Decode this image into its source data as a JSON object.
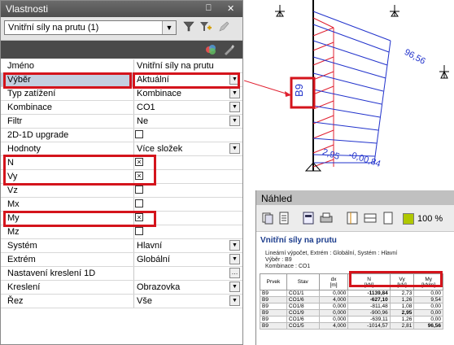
{
  "panel": {
    "title": "Vlastnosti",
    "pin_glyph": "⎕",
    "close_glyph": "✕",
    "selector_value": "Vnitřní síly na prutu (1)",
    "rows": [
      {
        "label": "Jméno",
        "value": "Vnitřní síly na prutu",
        "kind": "text"
      },
      {
        "label": "Výběr",
        "value": "Aktuální",
        "kind": "dropdown"
      },
      {
        "label": "Typ zatížení",
        "value": "Kombinace",
        "kind": "dropdown"
      },
      {
        "label": "Kombinace",
        "value": "CO1",
        "kind": "dropdown"
      },
      {
        "label": "Filtr",
        "value": "Ne",
        "kind": "dropdown"
      },
      {
        "label": "2D-1D upgrade",
        "value": "",
        "kind": "checkbox",
        "checked": false
      },
      {
        "label": "Hodnoty",
        "value": "Více složek",
        "kind": "dropdown"
      },
      {
        "label": "N",
        "value": "",
        "kind": "checkbox",
        "checked": true
      },
      {
        "label": "Vy",
        "value": "",
        "kind": "checkbox",
        "checked": true
      },
      {
        "label": "Vz",
        "value": "",
        "kind": "checkbox",
        "checked": false
      },
      {
        "label": "Mx",
        "value": "",
        "kind": "checkbox",
        "checked": false
      },
      {
        "label": "My",
        "value": "",
        "kind": "checkbox",
        "checked": true
      },
      {
        "label": "Mz",
        "value": "",
        "kind": "checkbox",
        "checked": false
      },
      {
        "label": "Systém",
        "value": "Hlavní",
        "kind": "dropdown"
      },
      {
        "label": "Extrém",
        "value": "Globální",
        "kind": "dropdown"
      },
      {
        "label": "Nastavení kreslení 1D",
        "value": "",
        "kind": "dots"
      },
      {
        "label": "Kreslení",
        "value": "Obrazovka",
        "kind": "dropdown"
      },
      {
        "label": "Řez",
        "value": "Vše",
        "kind": "dropdown"
      }
    ]
  },
  "drawing": {
    "member_label": "B9",
    "value_top": "96,56",
    "value_bottom_left": "2,95",
    "value_bottom_right": "-0,00,84"
  },
  "preview": {
    "title": "Náhled",
    "zoom": "100 %",
    "doc_title": "Vnitřní síly na prutu",
    "lines": [
      "Lineární výpočet, Extrém : Globální, Systém : Hlavní",
      "Výběr : B9",
      "Kombinace : CO1"
    ],
    "table": {
      "headers": [
        [
          "Prvek",
          ""
        ],
        [
          "Stav",
          ""
        ],
        [
          "dx",
          "[m]"
        ],
        [
          "N",
          "[kN]"
        ],
        [
          "Vy",
          "[kN]"
        ],
        [
          "My",
          "[kNm]"
        ]
      ],
      "rows": [
        [
          "B9",
          "CO1/1",
          "0,000",
          "-1139,84",
          "2,73",
          "0,00"
        ],
        [
          "B9",
          "CO1/6",
          "4,000",
          "-627,10",
          "1,26",
          "9,54"
        ],
        [
          "B9",
          "CO1/8",
          "0,000",
          "-811,48",
          "1,08",
          "0,00"
        ],
        [
          "B9",
          "CO1/9",
          "0,000",
          "-900,96",
          "2,95",
          "0,00"
        ],
        [
          "B9",
          "CO1/6",
          "0,000",
          "-639,11",
          "1,26",
          "0,00"
        ],
        [
          "B9",
          "CO1/5",
          "4,000",
          "-1014,57",
          "2,81",
          "96,56"
        ]
      ]
    }
  },
  "colors": {
    "highlight": "#d4141c",
    "positive": "#2233cc",
    "negative": "#e02030"
  }
}
